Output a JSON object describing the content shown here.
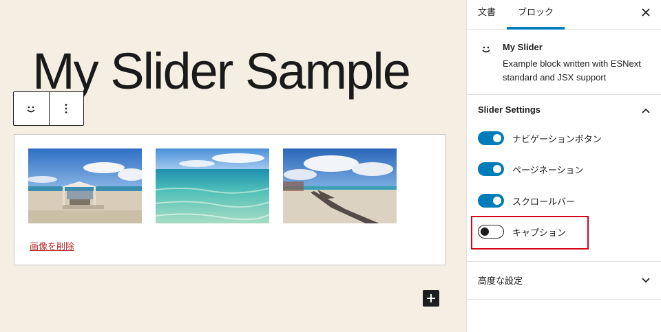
{
  "canvas": {
    "title": "My Slider Sample",
    "remove_images_link": "画像を削除",
    "slides": [
      {
        "alt": "beach cabana"
      },
      {
        "alt": "clear sea water"
      },
      {
        "alt": "beach lounge chairs"
      }
    ]
  },
  "sidebar": {
    "tabs": [
      "文書",
      "ブロック"
    ],
    "block": {
      "name": "My Slider",
      "description": "Example block written with ESNext standard and JSX support"
    },
    "slider_settings": {
      "title": "Slider Settings",
      "toggles": [
        {
          "label": "ナビゲーションボタン",
          "on": true
        },
        {
          "label": "ページネーション",
          "on": true
        },
        {
          "label": "スクロールバー",
          "on": true
        },
        {
          "label": "キャプション",
          "on": false
        }
      ]
    },
    "advanced": {
      "title": "高度な設定"
    }
  },
  "colors": {
    "accent": "#007cba",
    "highlight": "#d60017",
    "canvas_bg": "#f5efe3",
    "link": "#b32d2e"
  }
}
